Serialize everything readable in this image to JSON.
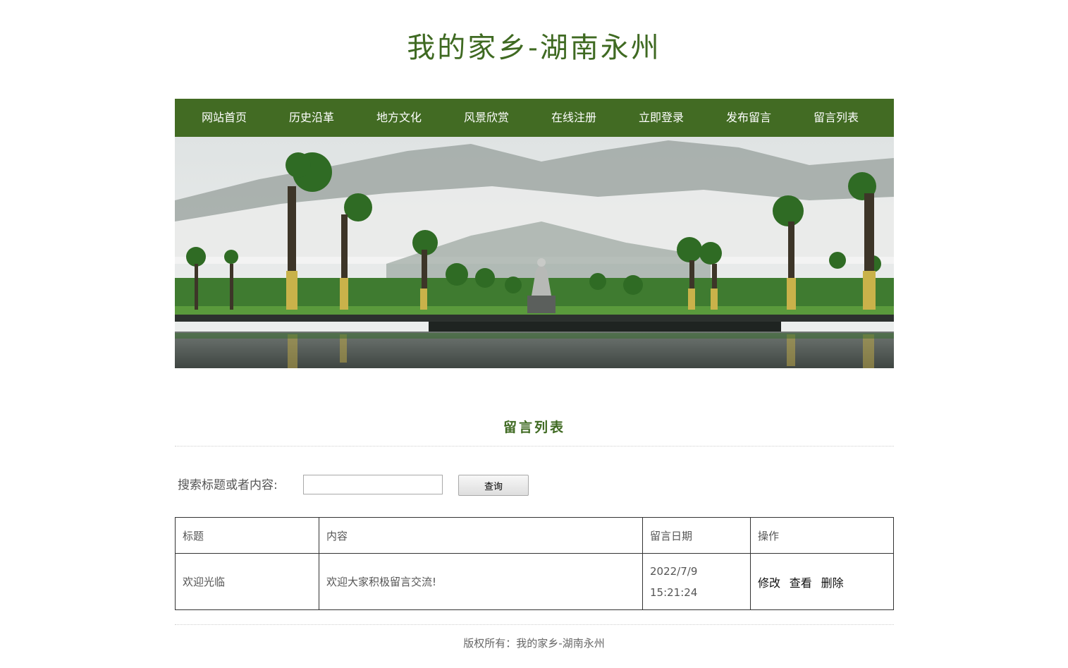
{
  "site_title": "我的家乡-湖南永州",
  "nav": {
    "items": [
      "网站首页",
      "历史沿革",
      "地方文化",
      "风景欣赏",
      "在线注册",
      "立即登录",
      "发布留言",
      "留言列表"
    ]
  },
  "section_title": "留言列表",
  "search": {
    "label": "搜索标题或者内容:",
    "value": "",
    "button": "查询"
  },
  "table": {
    "headers": [
      "标题",
      "内容",
      "留言日期",
      "操作"
    ],
    "rows": [
      {
        "title": "欢迎光临",
        "content": "欢迎大家积极留言交流!",
        "date": "2022/7/9",
        "time": "15:21:24",
        "actions": [
          "修改",
          "查看",
          "删除"
        ]
      }
    ]
  },
  "footer": "版权所有：我的家乡-湖南永州",
  "colors": {
    "brand_green": "#426b23",
    "title_green": "#3f6a22"
  }
}
